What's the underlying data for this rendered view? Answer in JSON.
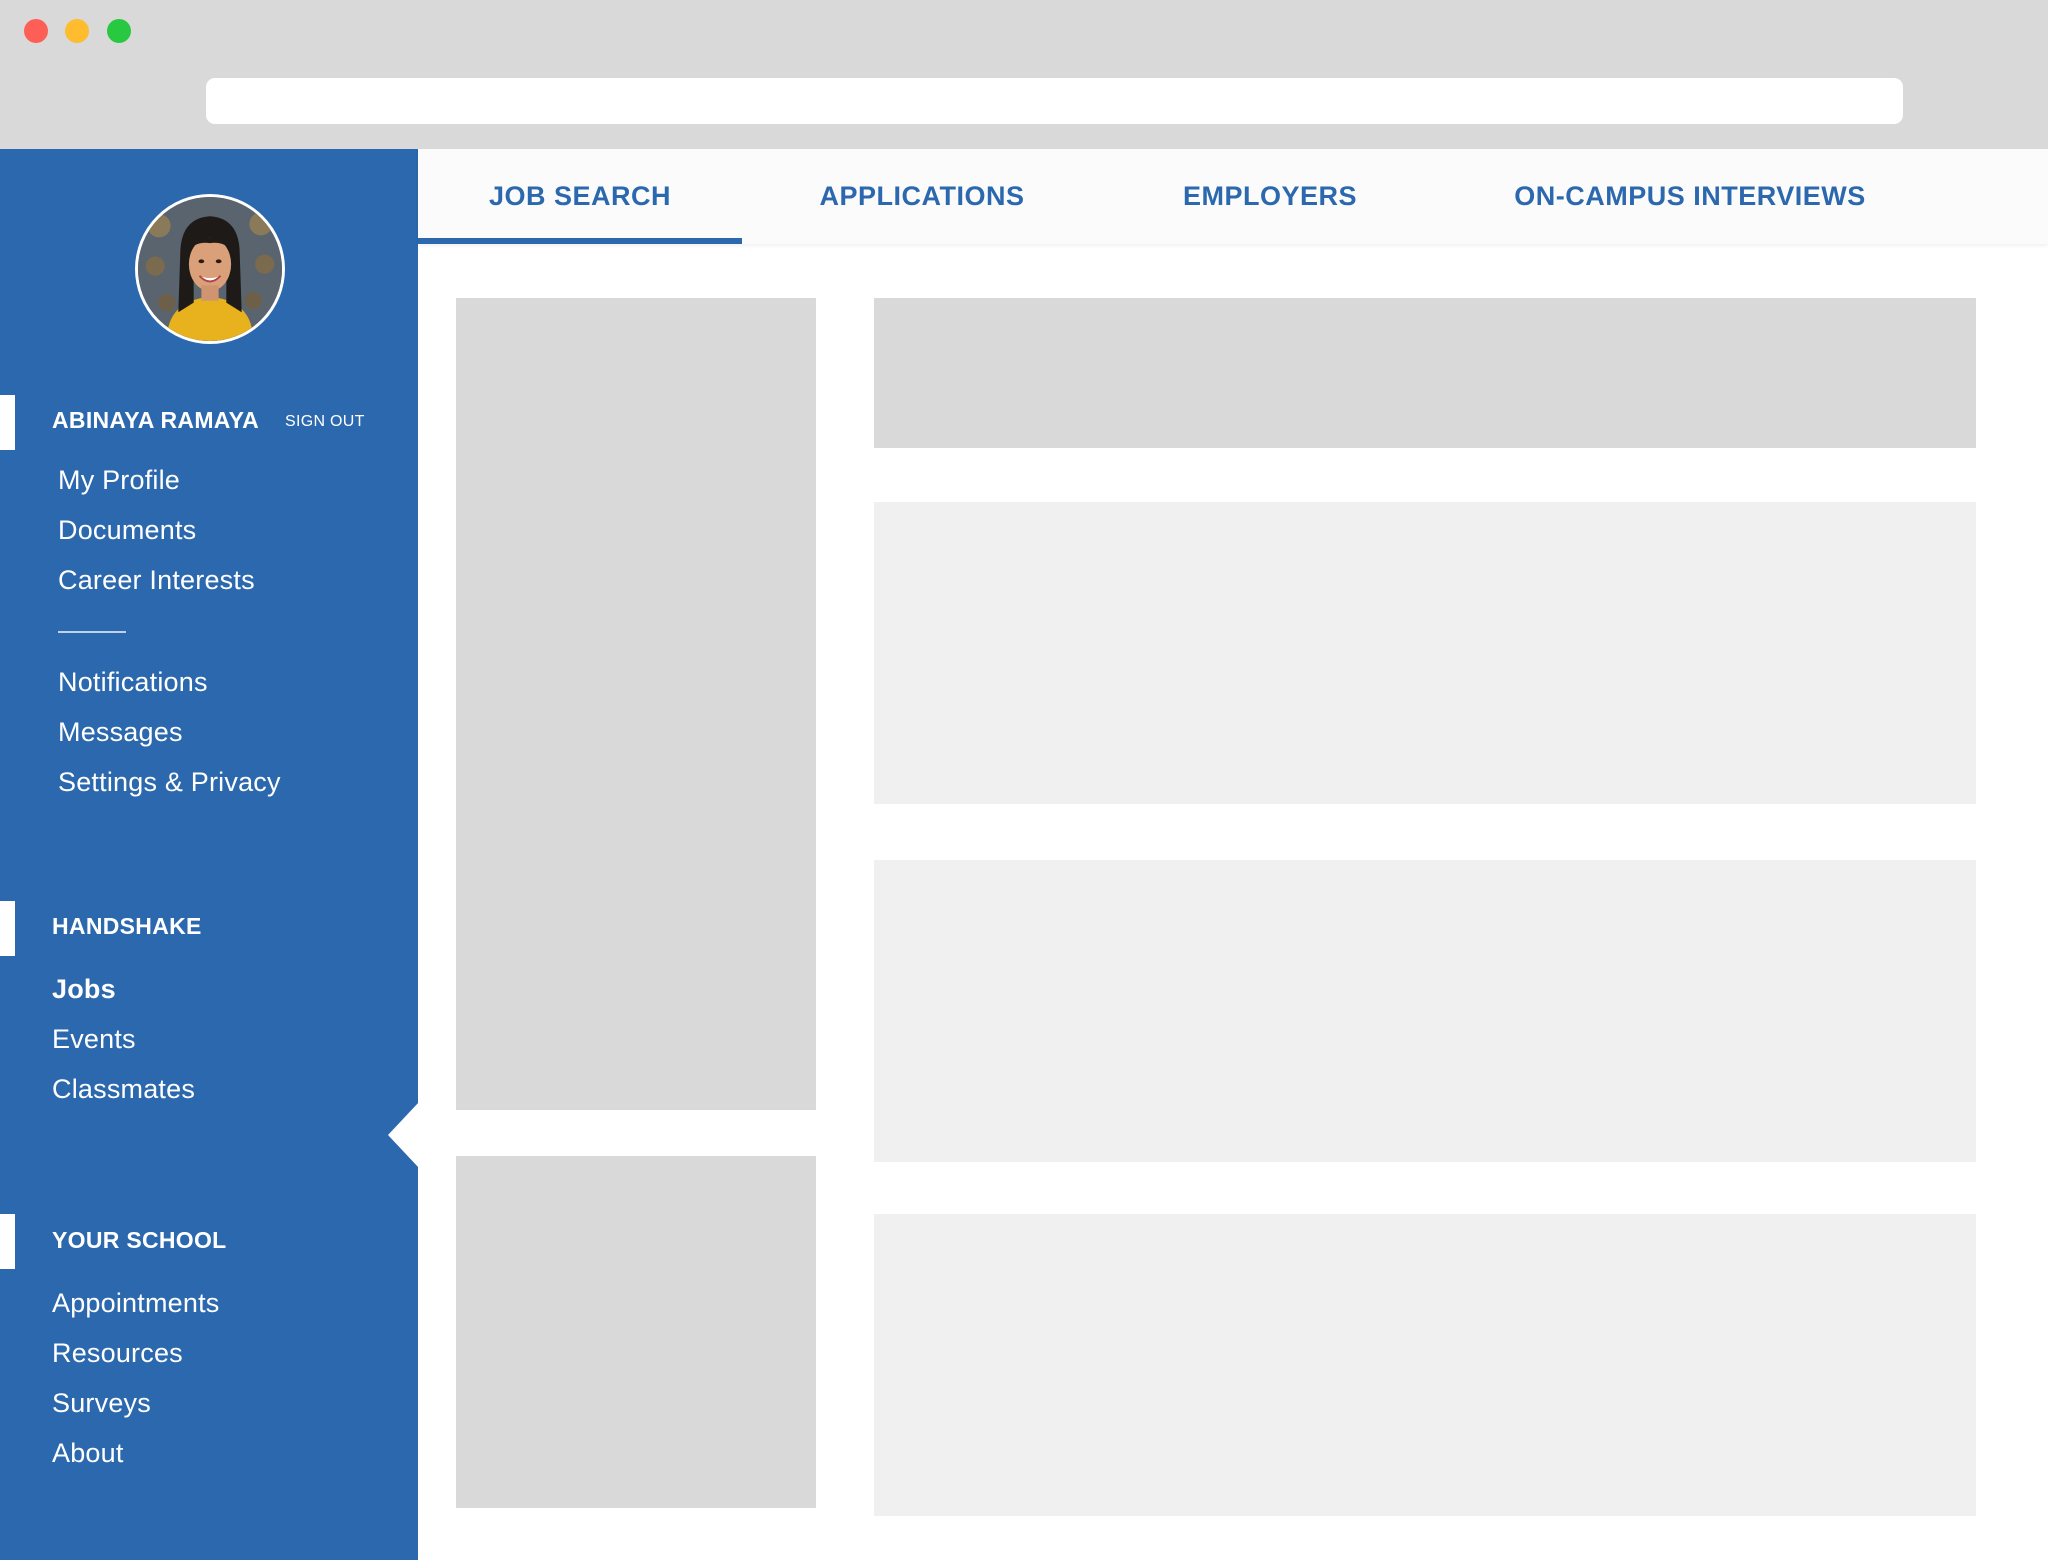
{
  "sidebar": {
    "user": {
      "name": "ABINAYA RAMAYA",
      "sign_out_label": "SIGN OUT"
    },
    "account_items": [
      {
        "label": "My Profile"
      },
      {
        "label": "Documents"
      },
      {
        "label": "Career Interests"
      }
    ],
    "account_items_2": [
      {
        "label": "Notifications"
      },
      {
        "label": "Messages"
      },
      {
        "label": "Settings & Privacy"
      }
    ],
    "handshake": {
      "title": "HANDSHAKE",
      "items": [
        {
          "label": "Jobs",
          "active": true
        },
        {
          "label": "Events"
        },
        {
          "label": "Classmates"
        }
      ]
    },
    "school": {
      "title": "YOUR SCHOOL",
      "items": [
        {
          "label": "Appointments"
        },
        {
          "label": "Resources"
        },
        {
          "label": "Surveys"
        },
        {
          "label": "About"
        }
      ]
    }
  },
  "tabs": [
    {
      "label": "JOB SEARCH",
      "active": true
    },
    {
      "label": "APPLICATIONS"
    },
    {
      "label": "EMPLOYERS"
    },
    {
      "label": "ON-CAMPUS INTERVIEWS"
    }
  ],
  "colors": {
    "brand_blue": "#2c68ae",
    "chrome_gray": "#d9d9d9",
    "placeholder_dark": "#d9d9d9",
    "placeholder_light": "#f0f0f0"
  }
}
